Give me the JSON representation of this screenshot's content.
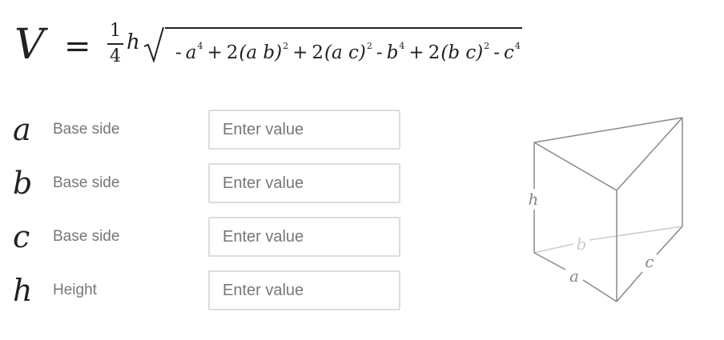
{
  "formula": {
    "lhs": "V",
    "equals": "=",
    "frac_num": "1",
    "frac_den": "4",
    "factor": "h",
    "radicand": {
      "t1_sign": "-",
      "t1_var": "a",
      "t1_exp": "4",
      "op1": "+",
      "t2_coef": "2",
      "t2_body": "(a b)",
      "t2_exp": "2",
      "op2": "+",
      "t3_coef": "2",
      "t3_body": "(a c)",
      "t3_exp": "2",
      "op3": "-",
      "t4_var": "b",
      "t4_exp": "4",
      "op4": "+",
      "t5_coef": "2",
      "t5_body": "(b c)",
      "t5_exp": "2",
      "op5": "-",
      "t6_var": "c",
      "t6_exp": "4"
    }
  },
  "fields": [
    {
      "var": "a",
      "label": "Base side",
      "value": "",
      "placeholder": "Enter value"
    },
    {
      "var": "b",
      "label": "Base side",
      "value": "",
      "placeholder": "Enter value"
    },
    {
      "var": "c",
      "label": "Base side",
      "value": "",
      "placeholder": "Enter value"
    },
    {
      "var": "h",
      "label": "Height",
      "value": "",
      "placeholder": "Enter value"
    }
  ],
  "diagram": {
    "label_h": "h",
    "label_a": "a",
    "label_b": "b",
    "label_c": "c",
    "edge_color": "#888888",
    "hidden_edge_color": "#cccccc"
  }
}
